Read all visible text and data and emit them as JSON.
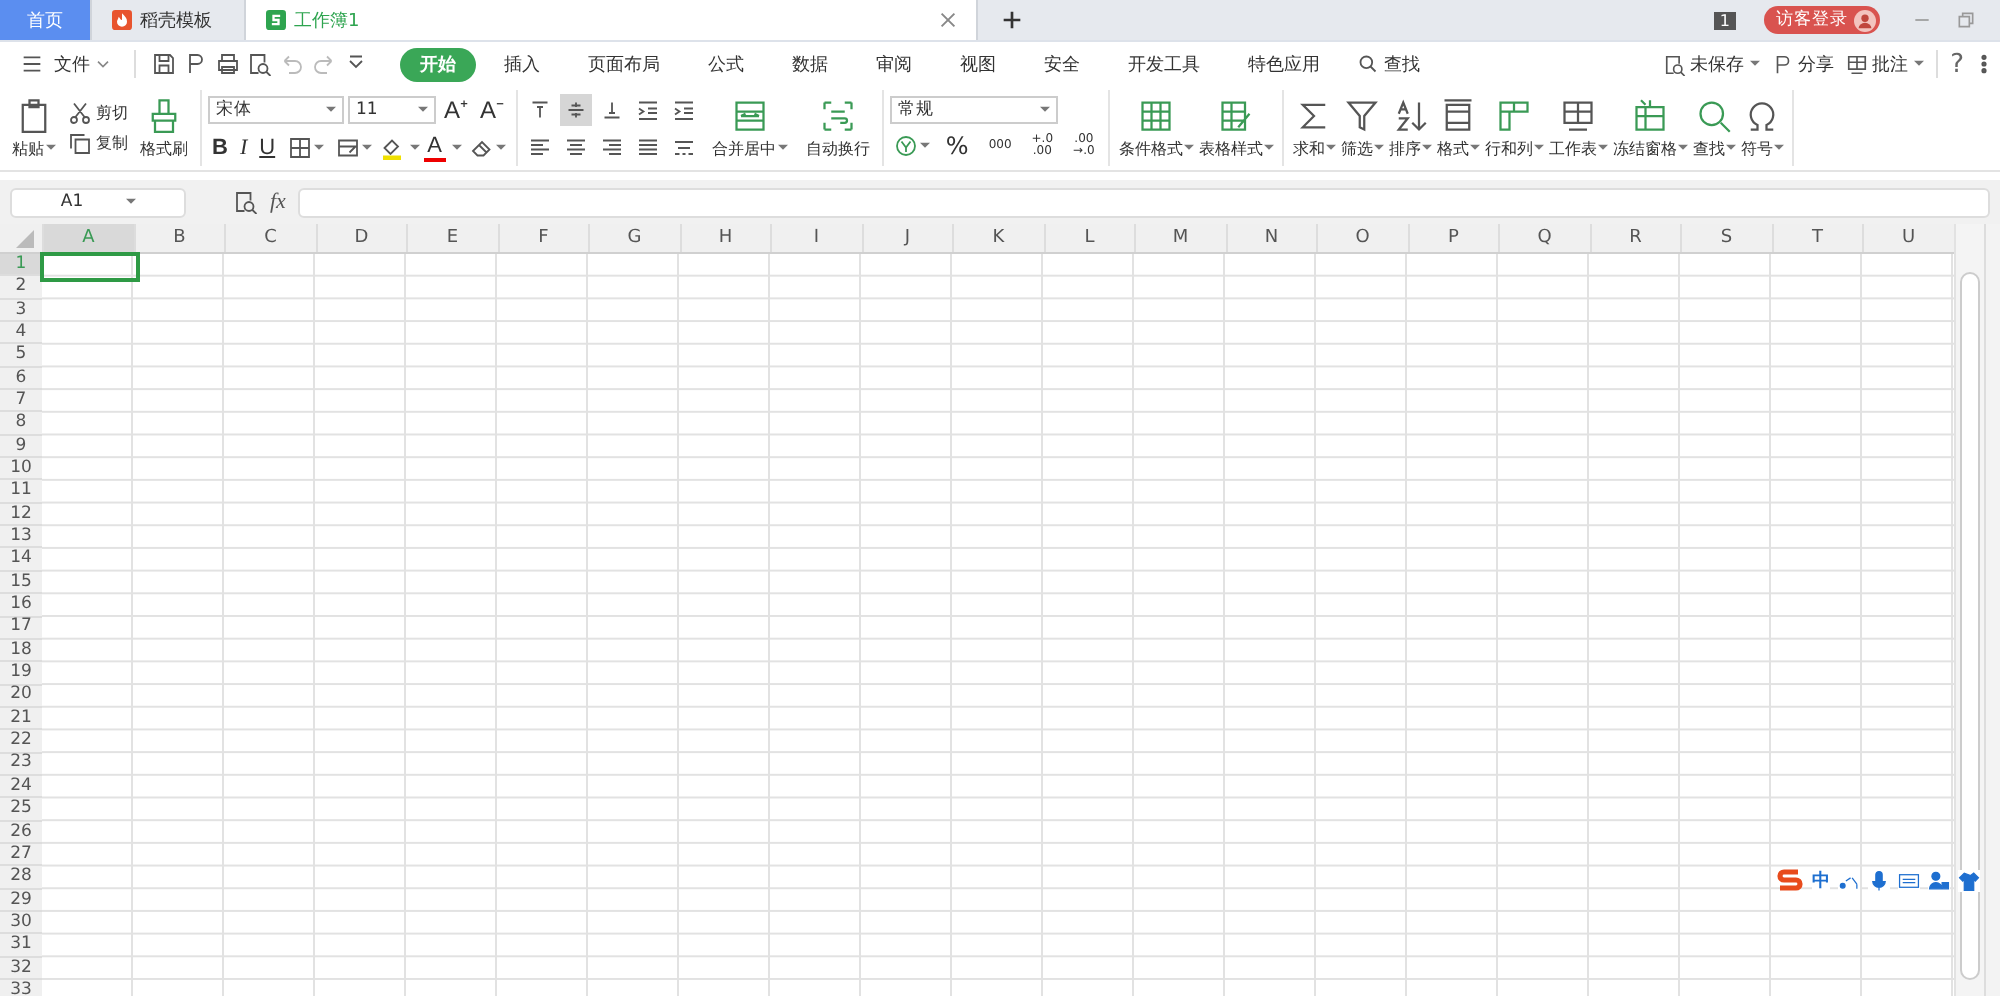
{
  "tabs": [
    {
      "label": "首页",
      "kind": "home",
      "selected": false
    },
    {
      "label": "稻壳模板",
      "kind": "docer",
      "selected": false
    },
    {
      "label": "工作簿1",
      "kind": "sheet",
      "selected": true
    }
  ],
  "title_bar": {
    "badge": "1",
    "login": "访客登录"
  },
  "menu": {
    "file": "文件",
    "tabs": [
      {
        "label": "开始",
        "selected": true
      },
      {
        "label": "插入",
        "selected": false
      },
      {
        "label": "页面布局",
        "selected": false
      },
      {
        "label": "公式",
        "selected": false
      },
      {
        "label": "数据",
        "selected": false
      },
      {
        "label": "审阅",
        "selected": false
      },
      {
        "label": "视图",
        "selected": false
      },
      {
        "label": "安全",
        "selected": false
      },
      {
        "label": "开发工具",
        "selected": false
      },
      {
        "label": "特色应用",
        "selected": false
      }
    ],
    "search": "查找",
    "right": [
      "未保存",
      "分享",
      "批注"
    ],
    "help": "?"
  },
  "ribbon": {
    "paste": "粘贴",
    "cut": "剪切",
    "copy": "复制",
    "format_painter": "格式刷",
    "font": "宋体",
    "font_size": "11",
    "grow": "A⁺",
    "shrink": "A⁻",
    "styles": [
      "B",
      "I",
      "U"
    ],
    "font_color": "A",
    "merge": "合并居中",
    "wrap": "自动换行",
    "number_format": "常规",
    "number_buttons": [
      "%",
      "000",
      "+.0\n.00",
      ".00\n→.0"
    ],
    "large_buttons": [
      "条件格式",
      "表格样式",
      "求和",
      "筛选",
      "排序",
      "格式",
      "行和列",
      "工作表",
      "冻结窗格",
      "查找",
      "符号"
    ]
  },
  "formula_bar": {
    "name_box": "A1",
    "fx": "fx"
  },
  "columns": [
    {
      "label": "A",
      "selected": true
    },
    {
      "label": "B",
      "selected": false
    },
    {
      "label": "C",
      "selected": false
    },
    {
      "label": "D",
      "selected": false
    },
    {
      "label": "E",
      "selected": false
    },
    {
      "label": "F",
      "selected": false
    },
    {
      "label": "G",
      "selected": false
    },
    {
      "label": "H",
      "selected": false
    },
    {
      "label": "I",
      "selected": false
    },
    {
      "label": "J",
      "selected": false
    },
    {
      "label": "K",
      "selected": false
    },
    {
      "label": "L",
      "selected": false
    },
    {
      "label": "M",
      "selected": false
    },
    {
      "label": "N",
      "selected": false
    },
    {
      "label": "O",
      "selected": false
    },
    {
      "label": "P",
      "selected": false
    },
    {
      "label": "Q",
      "selected": false
    },
    {
      "label": "R",
      "selected": false
    },
    {
      "label": "S",
      "selected": false
    },
    {
      "label": "T",
      "selected": false
    },
    {
      "label": "U",
      "selected": false
    }
  ],
  "rows": [
    {
      "label": "1",
      "selected": true
    },
    {
      "label": "2",
      "selected": false
    },
    {
      "label": "3",
      "selected": false
    },
    {
      "label": "4",
      "selected": false
    },
    {
      "label": "5",
      "selected": false
    },
    {
      "label": "6",
      "selected": false
    },
    {
      "label": "7",
      "selected": false
    },
    {
      "label": "8",
      "selected": false
    },
    {
      "label": "9",
      "selected": false
    },
    {
      "label": "10",
      "selected": false
    },
    {
      "label": "11",
      "selected": false
    },
    {
      "label": "12",
      "selected": false
    },
    {
      "label": "13",
      "selected": false
    },
    {
      "label": "14",
      "selected": false
    },
    {
      "label": "15",
      "selected": false
    },
    {
      "label": "16",
      "selected": false
    },
    {
      "label": "17",
      "selected": false
    },
    {
      "label": "18",
      "selected": false
    },
    {
      "label": "19",
      "selected": false
    },
    {
      "label": "20",
      "selected": false
    },
    {
      "label": "21",
      "selected": false
    },
    {
      "label": "22",
      "selected": false
    },
    {
      "label": "23",
      "selected": false
    },
    {
      "label": "24",
      "selected": false
    },
    {
      "label": "25",
      "selected": false
    },
    {
      "label": "26",
      "selected": false
    },
    {
      "label": "27",
      "selected": false
    },
    {
      "label": "28",
      "selected": false
    },
    {
      "label": "29",
      "selected": false
    },
    {
      "label": "30",
      "selected": false
    },
    {
      "label": "31",
      "selected": false
    },
    {
      "label": "32",
      "selected": false
    },
    {
      "label": "33",
      "selected": false
    }
  ],
  "ime_toolbar": {
    "mode": "中"
  }
}
